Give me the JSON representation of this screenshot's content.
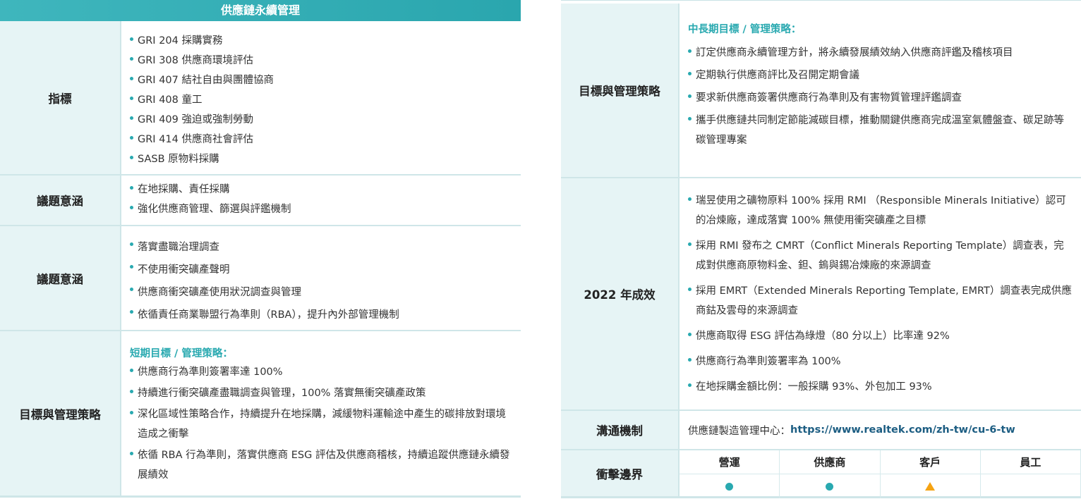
{
  "title": "供應鏈永續管理",
  "left": {
    "indicator": {
      "label": "指標",
      "items": [
        "GRI 204 採購實務",
        "GRI 308 供應商環境評估",
        "GRI 407 結社自由與團體協商",
        "GRI 408 童工",
        "GRI 409 強迫或強制勞動",
        "GRI 414 供應商社會評估",
        "SASB 原物料採購"
      ]
    },
    "issue1": {
      "label": "議題意涵",
      "items": [
        "在地採購、責任採購",
        "強化供應商管理、篩選與評鑑機制"
      ]
    },
    "issue2": {
      "label": "議題意涵",
      "items": [
        "落實盡職治理調查",
        "不使用衝突礦產聲明",
        "供應商衝突礦產使用狀況調查與管理",
        "依循責任商業聯盟行為準則（RBA），提升內外部管理機制"
      ]
    },
    "goals": {
      "label": "目標與管理策略",
      "subtitle": "短期目標 / 管理策略：",
      "items": [
        "供應商行為準則簽署率達 100%",
        "持續進行衝突礦產盡職調查與管理，100% 落實無衝突礦產政策",
        "深化區域性策略合作，持續提升在地採購，減緩物料運輸途中產生的碳排放對環境造成之衝擊",
        "依循 RBA 行為準則，落實供應商 ESG 評估及供應商稽核，持續追蹤供應鏈永續發展績效"
      ]
    }
  },
  "right": {
    "goals": {
      "label": "目標與管理策略",
      "subtitle": "中長期目標 / 管理策略：",
      "items": [
        "訂定供應商永續管理方針，將永續發展績效納入供應商評鑑及稽核項目",
        "定期執行供應商評比及召開定期會議",
        "要求新供應商簽署供應商行為準則及有害物質管理評鑑調查",
        "攜手供應鏈共同制定節能減碳目標，推動關鍵供應商完成溫室氣體盤查、碳足跡等碳管理專案"
      ]
    },
    "performance": {
      "label": "2022 年成效",
      "items": [
        "瑞昱使用之礦物原料 100% 採用 RMI （Responsible Minerals Initiative）認可的冶煉廠，達成落實 100% 無使用衝突礦產之目標",
        "採用 RMI 發布之 CMRT（Conflict Minerals Reporting Template）調查表，完成對供應商原物料金、鉭、鎢與錫冶煉廠的來源調查",
        "採用 EMRT（Extended Minerals Reporting Template, EMRT）調查表完成供應商鈷及雲母的來源調查",
        "供應商取得 ESG 評估為綠燈（80 分以上）比率達 92%",
        "供應商行為準則簽署率為 100%",
        "在地採購金額比例：一般採購 93%、外包加工 93%"
      ]
    },
    "communication": {
      "label": "溝通機制",
      "prefix": "供應鏈製造管理中心：",
      "link": "https://www.realtek.com/zh-tw/cu-6-tw"
    },
    "impact": {
      "label": "衝擊邊界",
      "columns": [
        "營運",
        "供應商",
        "客戶",
        "員工"
      ],
      "markers": [
        "dot",
        "dot",
        "triangle",
        "none"
      ],
      "colors": {
        "dot": "#29a9b0",
        "triangle": "#f5a313"
      }
    }
  }
}
